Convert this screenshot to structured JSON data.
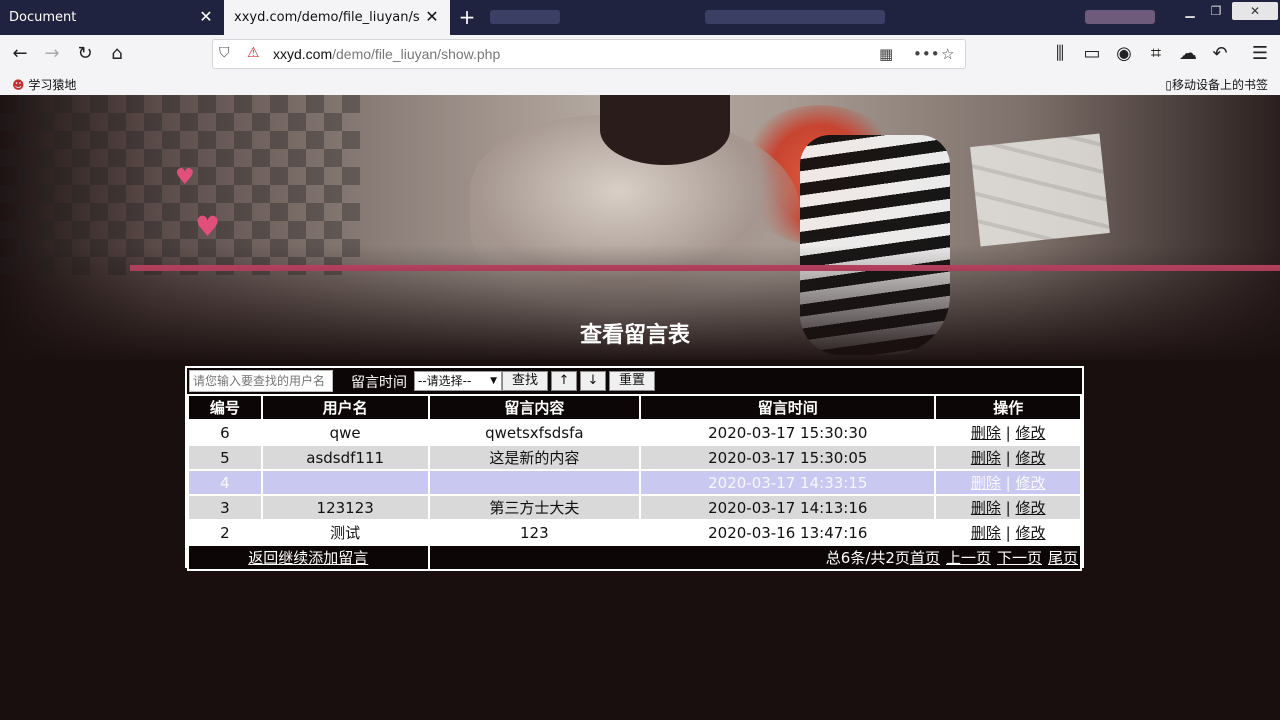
{
  "browser": {
    "tabs": [
      {
        "label": "Document"
      },
      {
        "label": "xxyd.com/demo/file_liuyan/show.php"
      }
    ],
    "url_domain": "xxyd.com",
    "url_path": "/demo/file_liuyan/show.php",
    "bookmark_left": "学习猿地",
    "bookmark_right": "移动设备上的书签"
  },
  "page": {
    "title": "查看留言表",
    "search": {
      "placeholder": "请您输入要查找的用户名",
      "time_label": "留言时间",
      "select_value": "--请选择--",
      "search_btn": "查找",
      "up_btn": "↑",
      "down_btn": "↓",
      "reset_btn": "重置"
    },
    "table": {
      "headers": [
        "编号",
        "用户名",
        "留言内容",
        "留言时间",
        "操作"
      ],
      "rows": [
        {
          "id": "6",
          "user": "qwe",
          "content": "qwetsxfsdsfa",
          "time": "2020-03-17 15:30:30"
        },
        {
          "id": "5",
          "user": "asdsdf111",
          "content": "这是新的内容",
          "time": "2020-03-17 15:30:05"
        },
        {
          "id": "4",
          "user": "",
          "content": "",
          "time": "2020-03-17 14:33:15"
        },
        {
          "id": "3",
          "user": "123123",
          "content": "第三方士大夫",
          "time": "2020-03-17 14:13:16"
        },
        {
          "id": "2",
          "user": "测试",
          "content": "123",
          "time": "2020-03-16 13:47:16"
        }
      ],
      "delete_label": "删除",
      "edit_label": "修改",
      "separator": "|"
    },
    "footer": {
      "back_link": "返回继续添加留言",
      "summary": "总6条/共2页",
      "first": "首页",
      "prev": "上一页",
      "next": "下一页",
      "last": "尾页"
    }
  }
}
